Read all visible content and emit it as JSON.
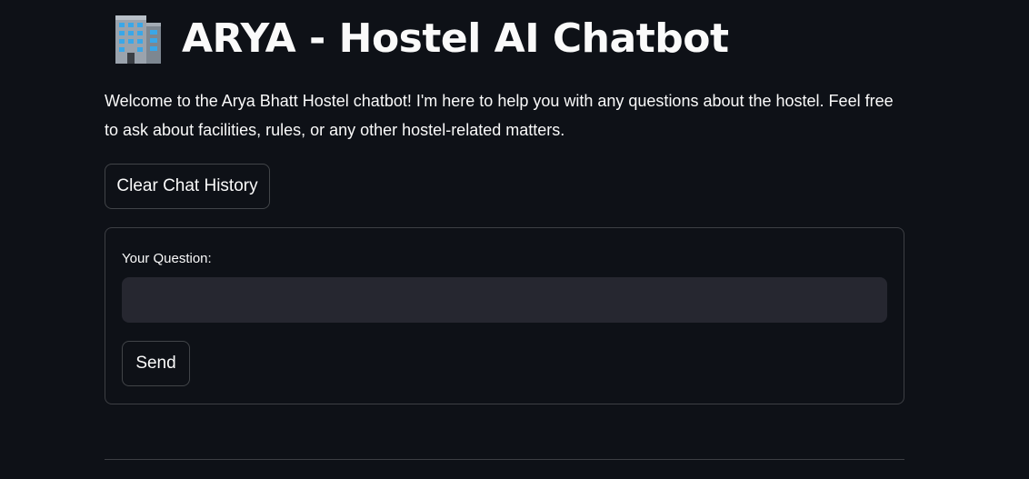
{
  "header": {
    "icon": "office-building-icon",
    "title": "ARYA - Hostel AI Chatbot"
  },
  "intro": {
    "text": "Welcome to the Arya Bhatt Hostel chatbot! I'm here to help you with any questions about the hostel. Feel free to ask about facilities, rules, or any other hostel-related matters."
  },
  "actions": {
    "clear_label": "Clear Chat History"
  },
  "form": {
    "question_label": "Your Question:",
    "question_value": "",
    "send_label": "Send"
  },
  "colors": {
    "background": "#0e1117",
    "input_background": "#262730",
    "text": "#fafafa"
  }
}
